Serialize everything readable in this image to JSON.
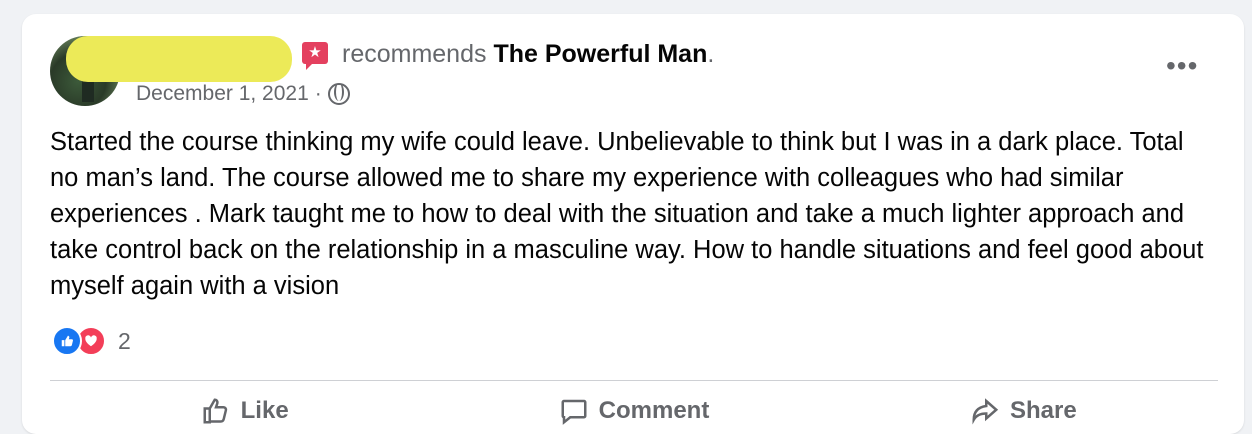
{
  "post": {
    "recommends_text": "recommends",
    "page_name": "The Powerful Man",
    "period": ".",
    "date": "December 1, 2021",
    "separator": "·",
    "audience_icon": "globe-icon",
    "more_label": "•••",
    "body": "Started the course thinking my wife could leave. Unbelievable to think but I was in a dark place. Total no man’s land. The course allowed me to share my experience with colleagues who had similar experiences . Mark taught me to how to deal with the situation and take a much lighter approach and take control back on the relationship in a masculine way. How to handle situations and feel good about myself again with a vision"
  },
  "reactions": {
    "icons": [
      "like-reaction-icon",
      "love-reaction-icon"
    ],
    "count": "2"
  },
  "actions": {
    "like_label": "Like",
    "comment_label": "Comment",
    "share_label": "Share"
  },
  "colors": {
    "background": "#f0f2f5",
    "card": "#ffffff",
    "secondary_text": "#65676b",
    "primary_text": "#050505",
    "recommend_icon": "#e4405f",
    "like_blue": "#1877f2",
    "love_red": "#f33e58",
    "redaction": "#ecea58"
  }
}
